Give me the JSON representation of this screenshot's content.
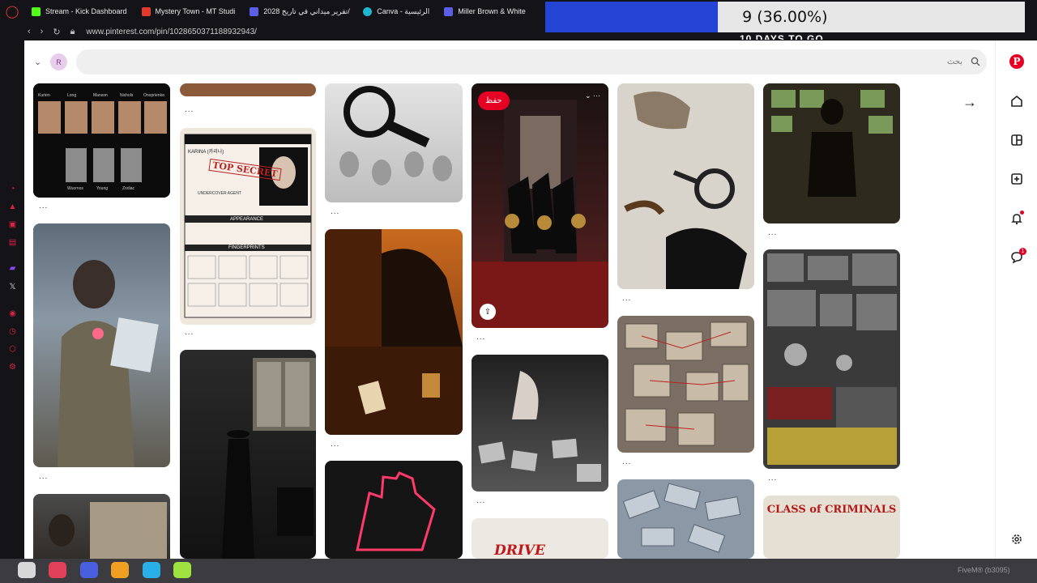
{
  "browser": {
    "tabs": [
      {
        "label": "Stream - Kick Dashboard",
        "color": "#53fc18"
      },
      {
        "label": "Mystery Town - MT Studi",
        "color": "#e23a2e"
      },
      {
        "label": "تقرير ميداني في تاريخ 2028/",
        "color": "#5b5fe8"
      },
      {
        "label": "Canva - الرئيسية",
        "color": "#1fb6d1"
      },
      {
        "label": "Miller Brown & White",
        "color": "#5b5fe8"
      }
    ],
    "url": "www.pinterest.com/pin/1028650371188932943/"
  },
  "overlay": {
    "value": "9 (36.00%)",
    "progress": 0.36,
    "subtitle": "10 DAYS TO GO"
  },
  "pinterest": {
    "avatar_letter": "R",
    "search_placeholder": "بحث",
    "nav": {
      "messages_badge": "1"
    },
    "save_label": "حفظ",
    "more_label": "...",
    "id_card": {
      "name": "KARINA (카리나)",
      "stamp": "TOP SECRET",
      "appearance": "APPEARANCE",
      "fingerprints": "FINGERPRINTS",
      "role": "UNDERCOVER AGENT"
    },
    "lineup": {
      "top_names": [
        "Kurten",
        "Long",
        "Manson",
        "Nichols",
        "Onoprienko"
      ],
      "bottom_names": [
        "Wuornos",
        "Young",
        "Zodiac"
      ]
    },
    "poster_title": "CLASS of CRIMINALS",
    "drive_text": "DRIVE"
  },
  "dock": {
    "text": "FiveM® (b3095)"
  }
}
